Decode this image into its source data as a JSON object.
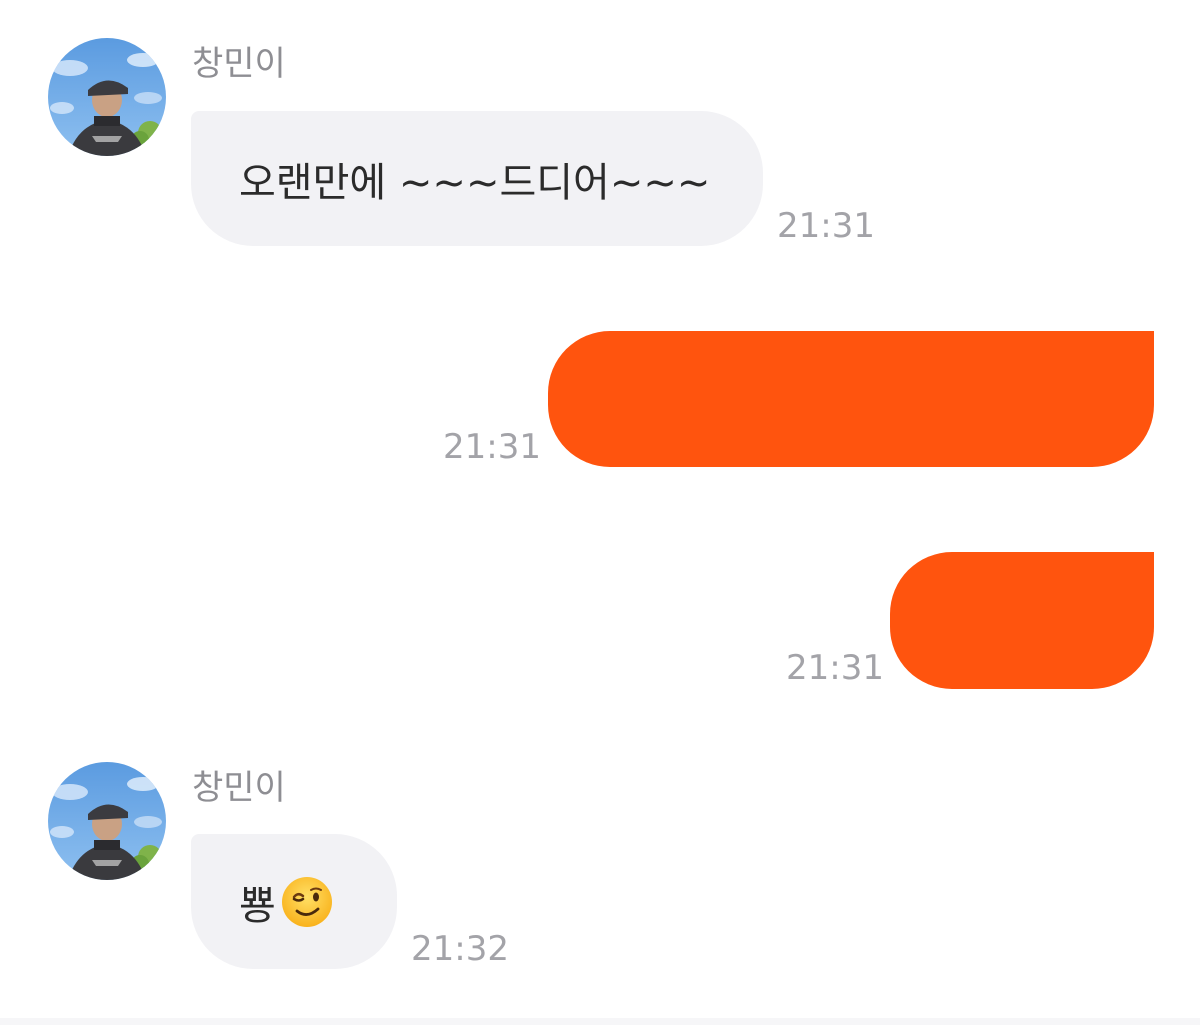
{
  "colors": {
    "incoming_bubble": "#f2f2f5",
    "outgoing_bubble": "#ff540e",
    "timestamp_text": "#a3a3a8",
    "sender_name_text": "#8e8e93"
  },
  "messages": [
    {
      "direction": "incoming",
      "sender": "창민이",
      "avatar_icon": "profile-photo-icon",
      "text": "오랜만에 ~~~드디어~~~",
      "time": "21:31"
    },
    {
      "direction": "outgoing",
      "text": "",
      "redacted": true,
      "time": "21:31"
    },
    {
      "direction": "outgoing",
      "text": "",
      "redacted": true,
      "time": "21:31"
    },
    {
      "direction": "incoming",
      "sender": "창민이",
      "avatar_icon": "profile-photo-icon",
      "text": "뿅",
      "emoji_icon": "winking-face-icon",
      "time": "21:32"
    }
  ]
}
